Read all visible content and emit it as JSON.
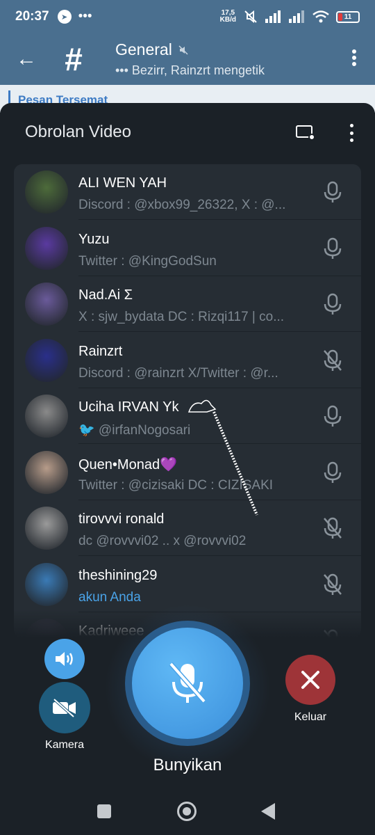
{
  "status_bar": {
    "time": "20:37",
    "dots": "•••",
    "net_speed_value": "17,5",
    "net_speed_unit": "KB/d",
    "battery": "11",
    "icons": [
      "telegram-icon",
      "mute-icon",
      "signal-icon",
      "signal-icon",
      "wifi-icon",
      "battery-icon"
    ]
  },
  "header": {
    "back_icon": "←",
    "channel_icon": "#",
    "title": "General",
    "typing": "••• Bezirr, Rainzrt mengetik"
  },
  "chat_peek": {
    "pinned": "Pesan Tersemat"
  },
  "sheet": {
    "title": "Obrolan Video",
    "participants": [
      {
        "name": "ALI WEN YAH",
        "about": "Discord : @xbox99_26322, X : @...",
        "mic": "on",
        "avatar_color": "#4d6b3a"
      },
      {
        "name": "Yuzu",
        "about": "Twitter : @KingGodSun",
        "mic": "on",
        "avatar_color": "#5a3aa0"
      },
      {
        "name": "Nad.Ai Σ",
        "about": "X : sjw_bydata DC : Rizqi117 | co...",
        "mic": "on",
        "avatar_color": "#6a5a9a"
      },
      {
        "name": "Rainzrt",
        "about": "Discord : @rainzrt X/Twitter : @r...",
        "mic": "off",
        "avatar_color": "#2a2f8a"
      },
      {
        "name": "Uciha IRVAN Yk",
        "about": "🐦 @irfanNogosari",
        "mic": "on",
        "avatar_color": "#8a8a8a"
      },
      {
        "name": "Quen•Monad💜",
        "about": "Twitter : @cizisaki DC : CIZISAKI",
        "mic": "on",
        "avatar_color": "#b79c8a"
      },
      {
        "name": "tirovvvi ronald",
        "about": "dc @rovvvi02 .. x @rovvvi02",
        "mic": "off",
        "avatar_color": "#9a9a9a"
      },
      {
        "name": "theshining29",
        "about": "akun Anda",
        "mic": "off",
        "avatar_color": "#3a7ab5",
        "is_me": true
      },
      {
        "name": "Kadriweee",
        "about": "",
        "mic": "off",
        "avatar_color": "#3a3a4a"
      }
    ]
  },
  "controls": {
    "camera_label": "Kamera",
    "mic_label": "Bunyikan",
    "leave_label": "Keluar",
    "colors": {
      "speaker": "#4aa3e8",
      "camera": "#1f5c7d",
      "mic": "#4aa3e8",
      "leave": "#9e3438"
    }
  }
}
